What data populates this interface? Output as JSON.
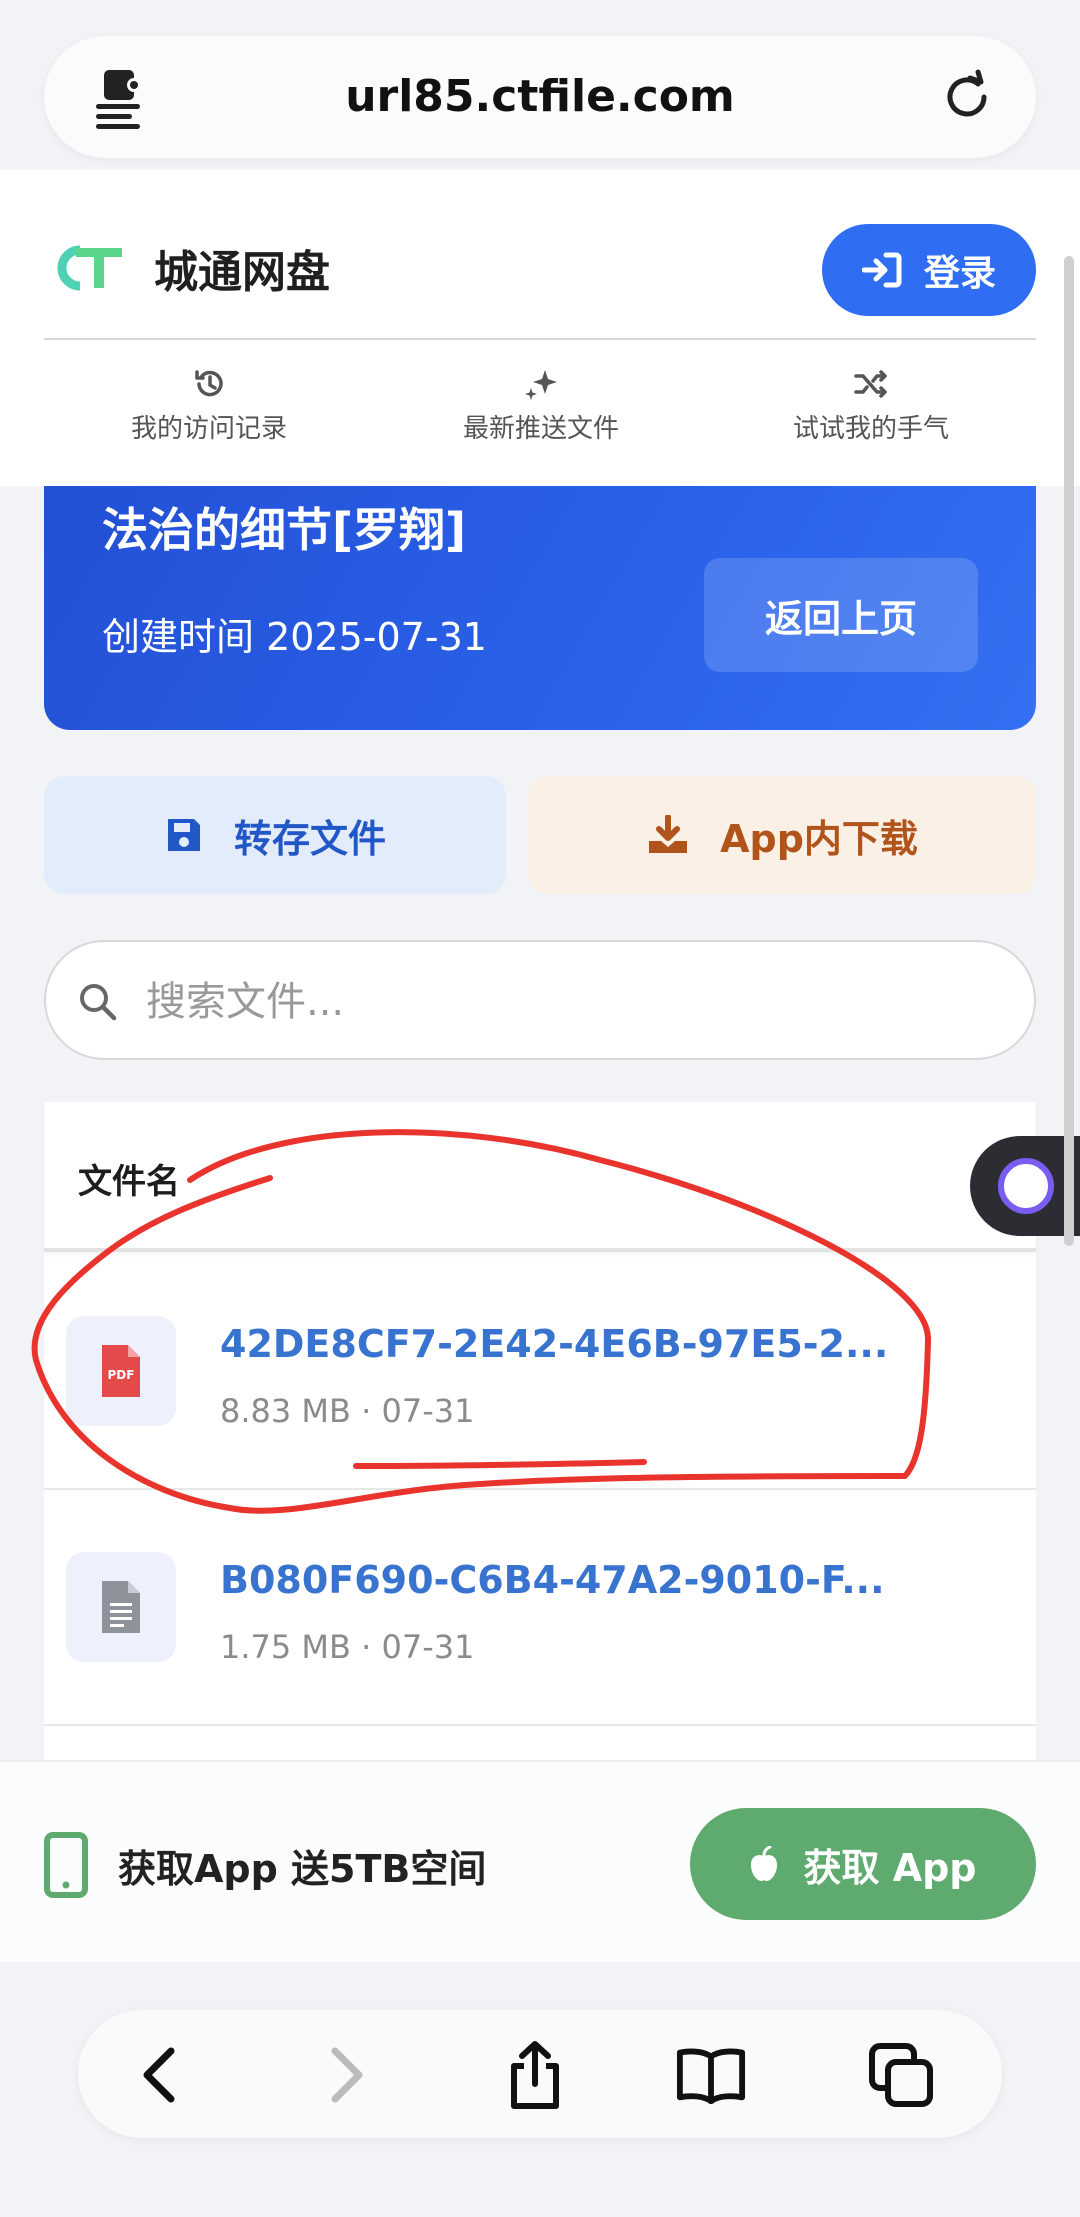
{
  "browser": {
    "url": "url85.ctfile.com"
  },
  "site": {
    "name": "城通网盘",
    "login_label": "登录",
    "nav": [
      {
        "label": "我的访问记录",
        "icon": "history-icon"
      },
      {
        "label": "最新推送文件",
        "icon": "sparkles-icon"
      },
      {
        "label": "试试我的手气",
        "icon": "shuffle-icon"
      }
    ]
  },
  "folder": {
    "title": "法治的细节[罗翔]",
    "created": "创建时间 2025-07-31",
    "back_label": "返回上页"
  },
  "actions": {
    "save_label": "转存文件",
    "download_label": "App内下载"
  },
  "search": {
    "placeholder": "搜索文件..."
  },
  "file_list": {
    "header": "文件名",
    "files": [
      {
        "name": "42DE8CF7-2E42-4E6B-97E5-2...",
        "meta": "8.83 MB · 07-31",
        "type": "pdf"
      },
      {
        "name": "B080F690-C6B4-47A2-9010-F...",
        "meta": "1.75 MB · 07-31",
        "type": "doc"
      }
    ]
  },
  "promo": {
    "text": "获取App 送5TB空间",
    "button_label": "获取 App"
  },
  "colors": {
    "brand_blue": "#2f6ef2",
    "save_bg": "#e3ecfb",
    "download_bg": "#fbf0e6",
    "app_green": "#5fab6f",
    "link_blue": "#3873cf",
    "annotation_red": "#e8342c"
  }
}
